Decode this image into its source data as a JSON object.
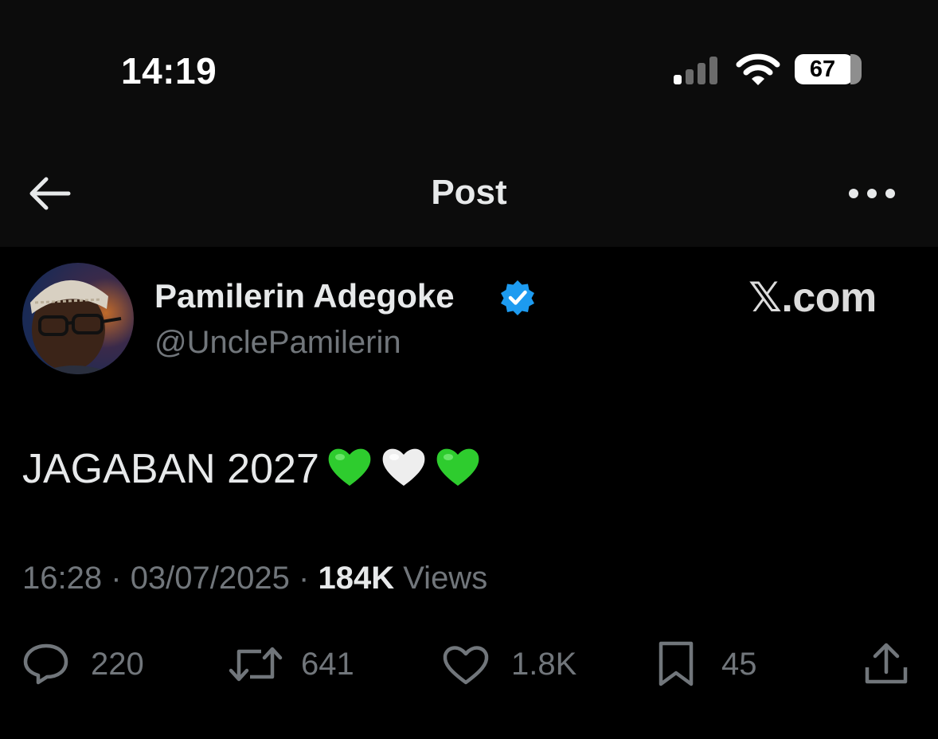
{
  "status_bar": {
    "time": "14:19",
    "battery_percent": "67",
    "signal_bars_filled": 1,
    "signal_bars_total": 4
  },
  "nav": {
    "title": "Post",
    "back_icon": "arrow-left-icon",
    "more_icon": "more-horizontal-icon"
  },
  "author": {
    "name": "Pamilerin Adegoke",
    "handle": "@UnclePamilerin",
    "verified": true
  },
  "watermark": "𝕏.com",
  "post": {
    "text": "JAGABAN 2027",
    "emoji": [
      "green-heart",
      "white-heart",
      "green-heart"
    ]
  },
  "meta": {
    "time": "16:28",
    "date": "03/07/2025",
    "separator": "·",
    "views_count": "184K",
    "views_label": "Views"
  },
  "actions": {
    "replies": "220",
    "reposts": "641",
    "likes": "1.8K",
    "bookmarks": "45"
  },
  "colors": {
    "background": "#000000",
    "bar_background": "#0c0c0c",
    "text": "#e7e9ea",
    "muted": "#71767b",
    "verified": "#1d9bf0",
    "green_heart": "#2ecc2e",
    "white_heart": "#eeeeee"
  }
}
